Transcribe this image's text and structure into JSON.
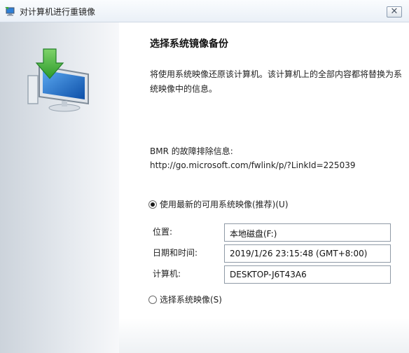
{
  "window": {
    "title": "对计算机进行重镜像",
    "close_label": "✕"
  },
  "page": {
    "heading": "选择系统镜像备份",
    "description": "将使用系统映像还原该计算机。该计算机上的全部内容都将替换为系统映像中的信息。",
    "bmr_label": "BMR 的故障排除信息:",
    "bmr_link": "http://go.microsoft.com/fwlink/p/?LinkId=225039"
  },
  "options": {
    "latest": {
      "label": "使用最新的可用系统映像(推荐)(U)",
      "selected": true
    },
    "select": {
      "label": "选择系统映像(S)",
      "selected": false
    }
  },
  "details": {
    "location": {
      "label": "位置:",
      "value": "本地磁盘(F:)"
    },
    "datetime": {
      "label": "日期和时间:",
      "value": "2019/1/26 23:15:48 (GMT+8:00)"
    },
    "computer": {
      "label": "计算机:",
      "value": "DESKTOP-J6T43A6"
    }
  },
  "icons": {
    "title": "restore-computer-icon",
    "hero": "computer-restore-arrow-icon"
  },
  "colors": {
    "arrow_green": "#3fae3a",
    "screen_blue": "#1f6fc9",
    "sidebar_gray": "#d3d9e0"
  }
}
